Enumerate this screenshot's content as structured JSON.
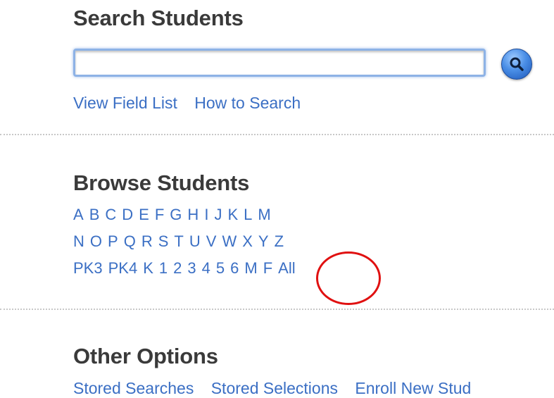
{
  "search": {
    "heading": "Search Students",
    "input_value": "",
    "input_placeholder": "",
    "links": [
      "View Field List",
      "How to Search"
    ]
  },
  "browse": {
    "heading": "Browse Students",
    "row1": [
      "A",
      "B",
      "C",
      "D",
      "E",
      "F",
      "G",
      "H",
      "I",
      "J",
      "K",
      "L",
      "M"
    ],
    "row2": [
      "N",
      "O",
      "P",
      "Q",
      "R",
      "S",
      "T",
      "U",
      "V",
      "W",
      "X",
      "Y",
      "Z"
    ],
    "row3": [
      "PK3",
      "PK4",
      "K",
      "1",
      "2",
      "3",
      "4",
      "5",
      "6",
      "M",
      "F",
      "All"
    ]
  },
  "other": {
    "heading": "Other Options",
    "links_partial": [
      "Stored Searches",
      "Stored Selections",
      "Enroll New Stud"
    ]
  },
  "colors": {
    "link": "#3b6fc4",
    "heading": "#3a3a3a",
    "annotation_circle": "#e01010"
  }
}
